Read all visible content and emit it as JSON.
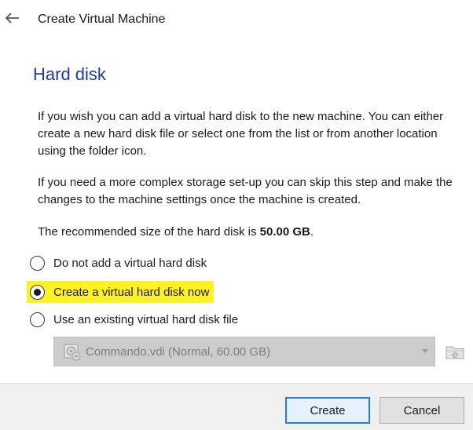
{
  "window": {
    "title": "Create Virtual Machine",
    "back_icon": "arrow-left-icon"
  },
  "page": {
    "heading": "Hard disk",
    "paragraph1": "If you wish you can add a virtual hard disk to the new machine. You can either create a new hard disk file or select one from the list or from another location using the folder icon.",
    "paragraph2": "If you need a more complex storage set-up you can skip this step and make the changes to the machine settings once the machine is created.",
    "recommend_prefix": "The recommended size of the hard disk is ",
    "recommend_size": "50.00 GB",
    "recommend_suffix": "."
  },
  "options": {
    "selected": "create_new",
    "no_disk": "Do not add a virtual hard disk",
    "create_new": "Create a virtual hard disk now",
    "use_existing": "Use an existing virtual hard disk file",
    "highlight_color": "#fff224"
  },
  "existing_disk": {
    "value": "Commando.vdi (Normal, 60.00 GB)",
    "enabled": false,
    "icon": "hard-disk-icon",
    "folder_icon": "folder-icon"
  },
  "buttons": {
    "create": "Create",
    "cancel": "Cancel"
  },
  "colors": {
    "heading": "#1a3f94",
    "default_button_border": "#2b79d8",
    "disabled_field": "#cccccc"
  }
}
